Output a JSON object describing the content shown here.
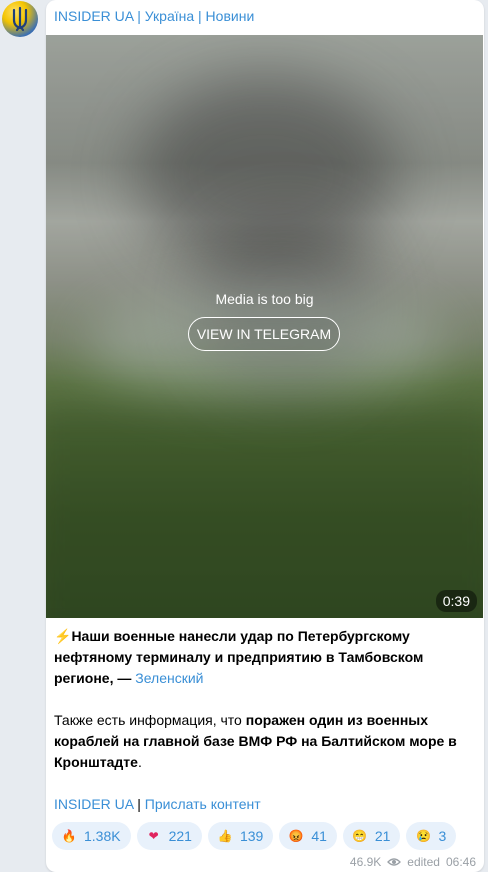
{
  "channel": {
    "name": "INSIDER UA | Україна | Новини"
  },
  "media": {
    "message": "Media is too big",
    "button_label": "VIEW IN TELEGRAM",
    "duration": "0:39"
  },
  "post": {
    "lightning_icon": "⚡",
    "bold_line": "Наши военные нанесли удар по Петербургскому нефтяному терминалу и предприятию в Тамбовском регионе, —",
    "author_link": "Зеленский",
    "para2_normal": "Также есть информация, что ",
    "para2_bold": "поражен один из военных кораблей на главной базе ВМФ РФ на Балтийском море в Кронштадте",
    "para2_end": ".",
    "footer_link1": "INSIDER UA",
    "footer_sep": " | ",
    "footer_link2": "Прислать контент"
  },
  "reactions": [
    {
      "icon": "fire-icon",
      "emoji": "🔥",
      "count": "1.38K"
    },
    {
      "icon": "heart-icon",
      "emoji": "❤",
      "count": "221"
    },
    {
      "icon": "thumbs-up-icon",
      "emoji": "👍",
      "count": "139"
    },
    {
      "icon": "angry-face-icon",
      "emoji": "😡",
      "count": "41"
    },
    {
      "icon": "grin-face-icon",
      "emoji": "😁",
      "count": "21"
    },
    {
      "icon": "crying-face-icon",
      "emoji": "😢",
      "count": "3"
    }
  ],
  "meta": {
    "views": "46.9K",
    "edited_label": "edited",
    "time": "06:46"
  },
  "colors": {
    "link": "#3a8fd6",
    "reaction_bg": "#e8f1fb"
  }
}
